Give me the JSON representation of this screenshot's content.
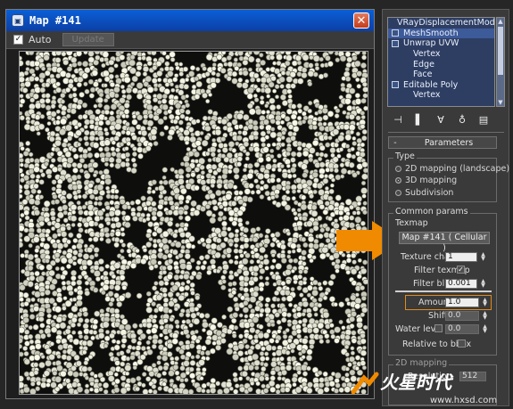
{
  "window": {
    "title": "Map #141",
    "close_glyph": "✕",
    "toolbar": {
      "auto_checkbox": "✓",
      "auto_label": "Auto",
      "update_label": "Update"
    }
  },
  "modifier_stack": {
    "items": [
      {
        "label": "VRayDisplacementMod",
        "icon": "bulb-icon"
      },
      {
        "label": "MeshSmooth",
        "icon": "expand-icon",
        "selected": true
      },
      {
        "label": "Unwrap UVW",
        "icon": "expand-icon"
      },
      {
        "label": "Vertex",
        "icon": "",
        "indent": true
      },
      {
        "label": "Edge",
        "icon": "",
        "indent": true
      },
      {
        "label": "Face",
        "icon": "",
        "indent": true
      },
      {
        "label": "Editable Poly",
        "icon": "expand-icon"
      },
      {
        "label": "Vertex",
        "icon": "",
        "indent": true
      }
    ]
  },
  "stack_toolbar": {
    "icons": [
      "pin-stack-icon",
      "show-end-result-icon",
      "make-unique-icon",
      "remove-modifier-icon",
      "configure-modifier-sets-icon"
    ]
  },
  "parameters": {
    "rollout_sign": "-",
    "rollout_title": "Parameters",
    "type_group": "Type",
    "types": [
      {
        "label": "2D mapping (landscape)",
        "selected": false,
        "dim": false
      },
      {
        "label": "3D mapping",
        "selected": true,
        "dim": false
      },
      {
        "label": "Subdivision",
        "selected": false,
        "dim": false
      }
    ],
    "common_group": "Common params",
    "texmap_label": "Texmap",
    "texmap_button": "Map #141  ( Cellular )",
    "texture_chan_label": "Texture chan",
    "texture_chan_value": "1",
    "filter_texmap_label": "Filter texmap",
    "filter_texmap_check": "✓",
    "filter_blur_label": "Filter blur",
    "filter_blur_value": "0.001",
    "amount_label": "Amount",
    "amount_value": "1.0",
    "shift_label": "Shift",
    "shift_value": "0.0",
    "water_level_label": "Water level",
    "water_level_value": "0.0",
    "relative_label": "Relative to bbox",
    "twod_group": "2D mapping",
    "resolution_label": "Resolution",
    "resolution_value": "512"
  },
  "watermark": {
    "brand": "火星时代",
    "url": "www.hxsd.com"
  },
  "colors": {
    "titlebar": "#0b4fc0",
    "highlight_arrow": "#f08a00",
    "amount_outline": "#e08a1a",
    "stack_bg": "#2e3e63"
  }
}
